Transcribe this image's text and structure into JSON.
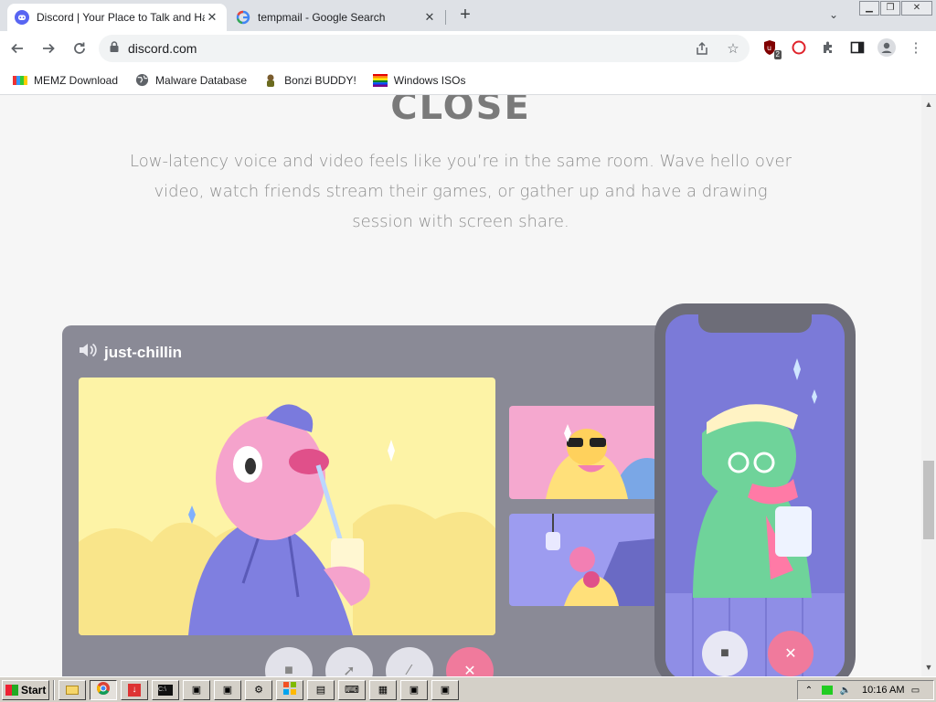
{
  "browser": {
    "tabs": [
      {
        "title": "Discord | Your Place to Talk and Hang",
        "active": true,
        "favicon": "discord-icon"
      },
      {
        "title": "tempmail - Google Search",
        "active": false,
        "favicon": "google-icon"
      }
    ],
    "new_tab_label": "+",
    "url": "discord.com",
    "bookmarks": [
      {
        "label": "MEMZ Download",
        "icon": "memz-icon"
      },
      {
        "label": "Malware Database",
        "icon": "globe-icon"
      },
      {
        "label": "Bonzi BUDDY!",
        "icon": "bonzi-icon"
      },
      {
        "label": "Windows ISOs",
        "icon": "windows-icon"
      }
    ],
    "extension_badge": "2"
  },
  "page": {
    "headline": "CLOSE",
    "description": "Low-latency voice and video feels like you’re in the same room. Wave hello over video, watch friends stream their games, or gather up and have a drawing session with screen share.",
    "channel_name": "just-chillin"
  },
  "taskbar": {
    "start_label": "Start",
    "clock": "10:16 AM"
  },
  "colors": {
    "call_window": "#8a8a96",
    "main_tile": "#fdf3a6",
    "tile_pink": "#f5a8cf",
    "tile_purple": "#9d9cf0",
    "phone_screen": "#7b7ad8",
    "hang_up": "#f07a9c"
  }
}
